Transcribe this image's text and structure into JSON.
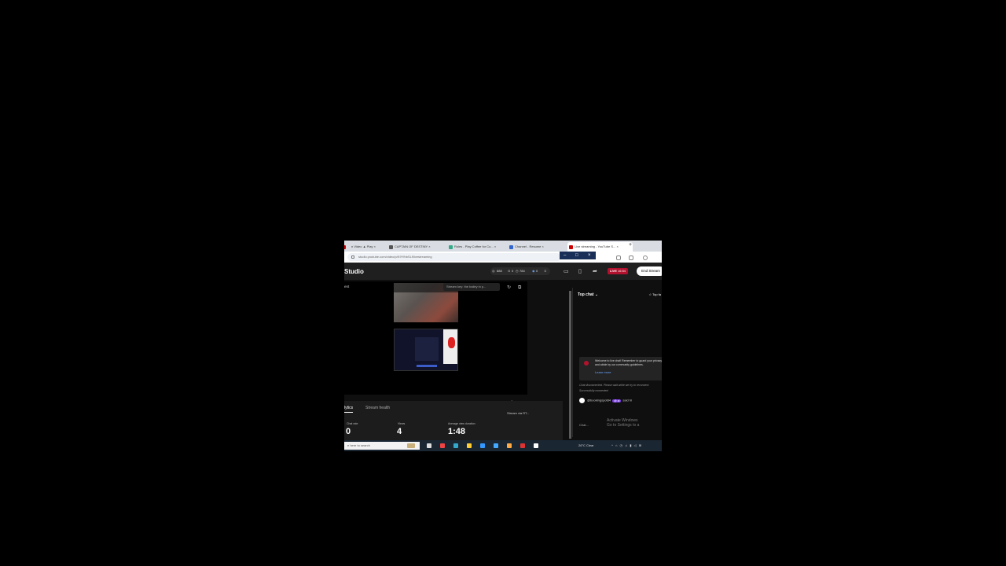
{
  "browser": {
    "tabs": [
      {
        "label": "n Video ▲ Play ×",
        "color": "#c00"
      },
      {
        "label": "CAPTAIN OF DESTINY ×",
        "color": "#555"
      },
      {
        "label": "Roles - Play Coffee for Co... ×",
        "color": "#3a8"
      },
      {
        "label": "Channel - Resume ×",
        "color": "#36c"
      },
      {
        "label": "Live streaming - YouTube S... ×",
        "color": "#c00"
      }
    ],
    "new_tab": "+",
    "url": "studio.youtube.com/video/p/K9YfhbSLf/livestreaming",
    "window_controls": {
      "minimize": "–",
      "maximize": "□",
      "close": "×"
    }
  },
  "studio": {
    "title": "Studio",
    "stats": {
      "watching": "888",
      "concurrent": "0",
      "likes": "784",
      "subs": "0"
    },
    "live_label": "LIVE",
    "live_time": "16:54",
    "end_stream": "End Stream"
  },
  "preview": {
    "stream_key": "Stream key: the bailey in p...",
    "left_label": "ent"
  },
  "analytics": {
    "tabs": [
      "lytics",
      "Stream health"
    ],
    "metrics": [
      {
        "label": "Chat rate",
        "value": "0"
      },
      {
        "label": "Views",
        "value": "4"
      },
      {
        "label": "Average view duration",
        "value": "1:48"
      }
    ],
    "message_placeholder": "Type a message...",
    "stream_via": "Stream via RT..."
  },
  "chat": {
    "header": "Top chat ⌄",
    "top_fans": "☆ Top fa",
    "welcome_text": "Welcome to live chat! Remember to guard your privacy and abide by our community guidelines.",
    "learn_more": "Learn more",
    "system_messages": [
      "Chat disconnected. Please wait while we try to reconnect.",
      "Successfully connected"
    ],
    "message": {
      "author": "@bookingspot84",
      "badge": "@ ai",
      "text": "said hi"
    },
    "input_placeholder": "Chat...",
    "activate_windows": [
      "Activate Windows",
      "Go to Settings to a"
    ]
  },
  "taskbar": {
    "search_placeholder": "e here to search",
    "weather": "26°C Clear",
    "tray": "^ ⌂ ◷ ♫ ▮ ◁ ⊞"
  }
}
